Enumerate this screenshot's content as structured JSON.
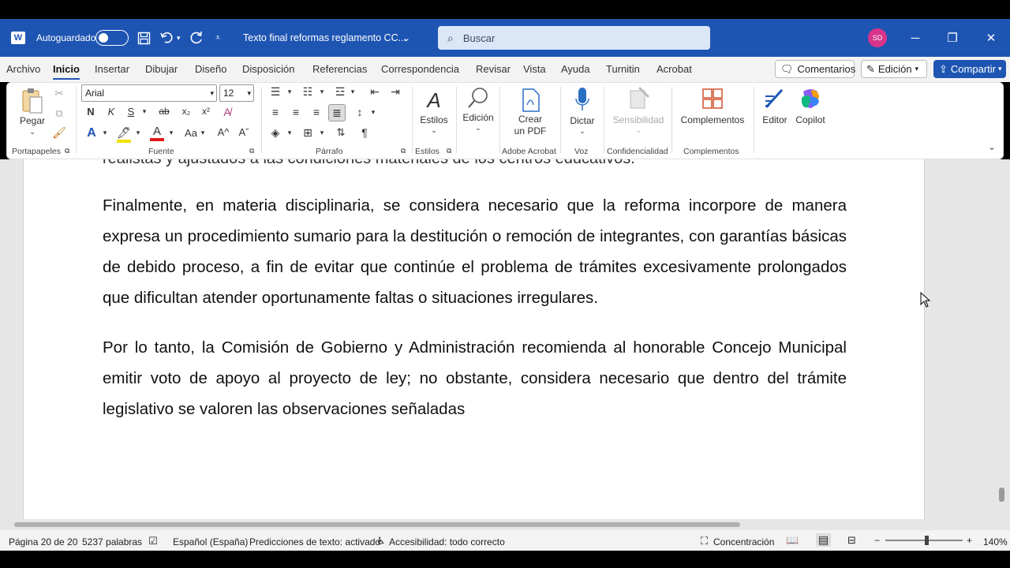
{
  "titlebar": {
    "autosave_label": "Autoguardado",
    "doc_title": "Texto final reformas reglamento CC...",
    "search_placeholder": "Buscar",
    "avatar_initials": "SD"
  },
  "tabs": [
    "Archivo",
    "Inicio",
    "Insertar",
    "Dibujar",
    "Diseño",
    "Disposición",
    "Referencias",
    "Correspondencia",
    "Revisar",
    "Vista",
    "Ayuda",
    "Turnitin",
    "Acrobat"
  ],
  "tab_buttons": {
    "comments": "Comentarios",
    "editing": "Edición",
    "share": "Compartir"
  },
  "ribbon": {
    "paste": "Pegar",
    "font_name": "Arial",
    "font_size": "12",
    "styles": "Estilos",
    "editing": "Edición",
    "create_pdf_1": "Crear",
    "create_pdf_2": "un PDF",
    "dictate": "Dictar",
    "sensitivity": "Sensibilidad",
    "addins": "Complementos",
    "editor": "Editor",
    "copilot": "Copilot",
    "groups": {
      "clipboard": "Portapapeles",
      "font": "Fuente",
      "paragraph": "Párrafo",
      "styles": "Estilos",
      "acrobat": "Adobe Acrobat",
      "voice": "Voz",
      "confidentiality": "Confidencialidad",
      "addins": "Complementos"
    }
  },
  "document": {
    "cut_line": "realistas y ajustados a las condiciones materiales de los centros educativos.",
    "paragraph_1": "Finalmente, en materia disciplinaria, se considera necesario que la reforma incorpore de manera expresa un procedimiento sumario para la destitución o remoción de integrantes, con garantías básicas de debido proceso, a fin de evitar que continúe el problema de trámites excesivamente prolongados que dificultan atender oportunamente faltas o situaciones irregulares.",
    "paragraph_2": "Por lo tanto, la Comisión de Gobierno y Administración recomienda al honorable Concejo Municipal emitir voto de apoyo al proyecto de ley; no obstante, considera necesario que dentro del trámite legislativo se valoren las observaciones señaladas"
  },
  "statusbar": {
    "page": "Página 20 de 20",
    "words": "5237 palabras",
    "language": "Español (España)",
    "predictions": "Predicciones de texto: activado",
    "accessibility": "Accesibilidad: todo correcto",
    "focus": "Concentración",
    "zoom": "140%"
  },
  "colors": {
    "titlebar": "#1e55b3",
    "accent": "#1e55b3",
    "avatar": "#d8348c"
  }
}
